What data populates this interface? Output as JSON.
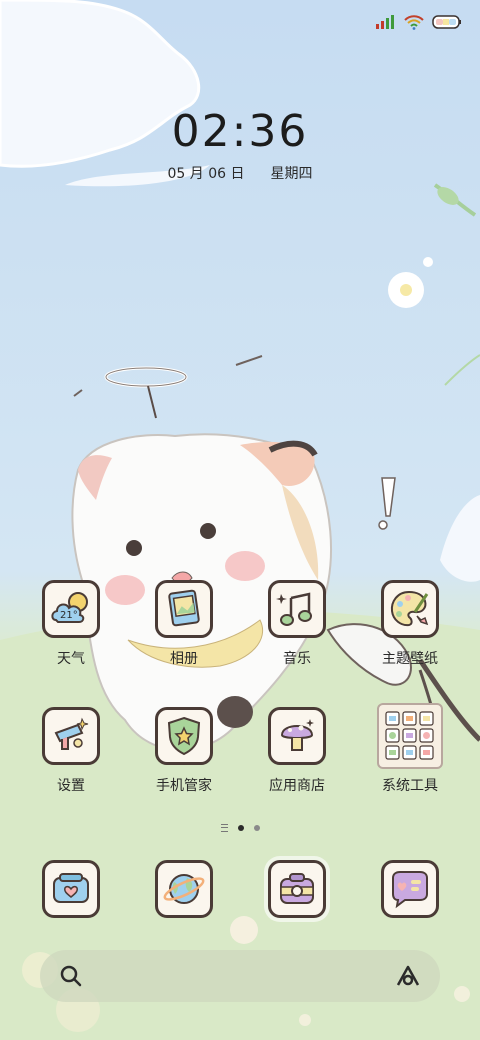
{
  "status_bar": {
    "signal_icon": "signal-icon",
    "wifi_icon": "wifi-icon",
    "battery_icon": "battery-icon"
  },
  "clock": {
    "time": "02:36",
    "date": "05 月 06 日",
    "weekday": "星期四"
  },
  "apps_row1": [
    {
      "label": "天气",
      "icon": "weather-icon",
      "temp": "21°"
    },
    {
      "label": "相册",
      "icon": "gallery-icon"
    },
    {
      "label": "音乐",
      "icon": "music-icon"
    },
    {
      "label": "主题壁纸",
      "icon": "theme-icon"
    }
  ],
  "apps_row2": [
    {
      "label": "设置",
      "icon": "settings-icon"
    },
    {
      "label": "手机管家",
      "icon": "security-icon"
    },
    {
      "label": "应用商店",
      "icon": "app-store-icon"
    },
    {
      "label": "系统工具",
      "icon": "folder-icon"
    }
  ],
  "dock": [
    {
      "icon": "phone-icon"
    },
    {
      "icon": "browser-icon"
    },
    {
      "icon": "camera-icon"
    },
    {
      "icon": "messages-icon"
    }
  ],
  "page_indicator": {
    "pages": 2,
    "current": 1
  },
  "search_bar": {
    "search_icon": "search-icon",
    "assistant_icon": "assistant-icon"
  },
  "colors": {
    "sky": "#c9dff3",
    "grass": "#d7e8c6",
    "tile_border": "#4a3b36",
    "tile_bg": "#fbf6ee"
  }
}
